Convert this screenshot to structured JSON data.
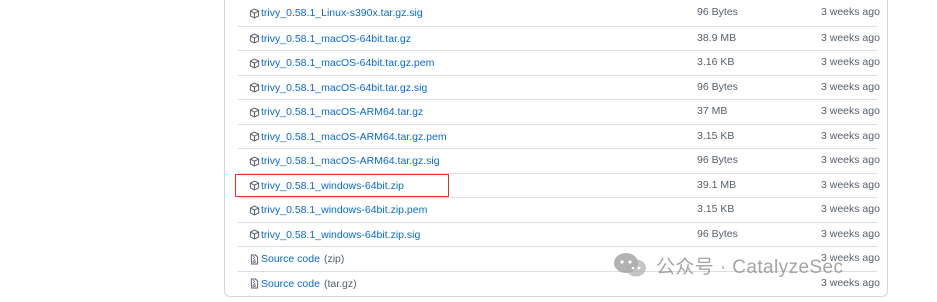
{
  "assets": [
    {
      "name": "trivy_0.58.1_Linux-s390x.tar.gz.sig",
      "size": "96 Bytes",
      "updated": "3 weeks ago",
      "icon": "package-icon"
    },
    {
      "name": "trivy_0.58.1_macOS-64bit.tar.gz",
      "size": "38.9 MB",
      "updated": "3 weeks ago",
      "icon": "package-icon"
    },
    {
      "name": "trivy_0.58.1_macOS-64bit.tar.gz.pem",
      "size": "3.16 KB",
      "updated": "3 weeks ago",
      "icon": "package-icon"
    },
    {
      "name": "trivy_0.58.1_macOS-64bit.tar.gz.sig",
      "size": "96 Bytes",
      "updated": "3 weeks ago",
      "icon": "package-icon"
    },
    {
      "name": "trivy_0.58.1_macOS-ARM64.tar.gz",
      "size": "37 MB",
      "updated": "3 weeks ago",
      "icon": "package-icon"
    },
    {
      "name": "trivy_0.58.1_macOS-ARM64.tar.gz.pem",
      "size": "3.15 KB",
      "updated": "3 weeks ago",
      "icon": "package-icon"
    },
    {
      "name": "trivy_0.58.1_macOS-ARM64.tar.gz.sig",
      "size": "96 Bytes",
      "updated": "3 weeks ago",
      "icon": "package-icon"
    },
    {
      "name": "trivy_0.58.1_windows-64bit.zip",
      "size": "39.1 MB",
      "updated": "3 weeks ago",
      "icon": "package-icon",
      "highlighted": true
    },
    {
      "name": "trivy_0.58.1_windows-64bit.zip.pem",
      "size": "3.15 KB",
      "updated": "3 weeks ago",
      "icon": "package-icon"
    },
    {
      "name": "trivy_0.58.1_windows-64bit.zip.sig",
      "size": "96 Bytes",
      "updated": "3 weeks ago",
      "icon": "package-icon"
    },
    {
      "name": "Source code",
      "format": "(zip)",
      "size": "",
      "updated": "3 weeks ago",
      "icon": "file-zip-icon"
    },
    {
      "name": "Source code",
      "format": "(tar.gz)",
      "size": "",
      "updated": "3 weeks ago",
      "icon": "file-zip-icon"
    }
  ],
  "watermark": {
    "text": "公众号 · CatalyzeSec",
    "icon": "wechat-logo-icon"
  },
  "colors": {
    "link": "#0969da",
    "muted": "#57606a",
    "border": "#d0d7de",
    "highlight": "#e2332c"
  }
}
